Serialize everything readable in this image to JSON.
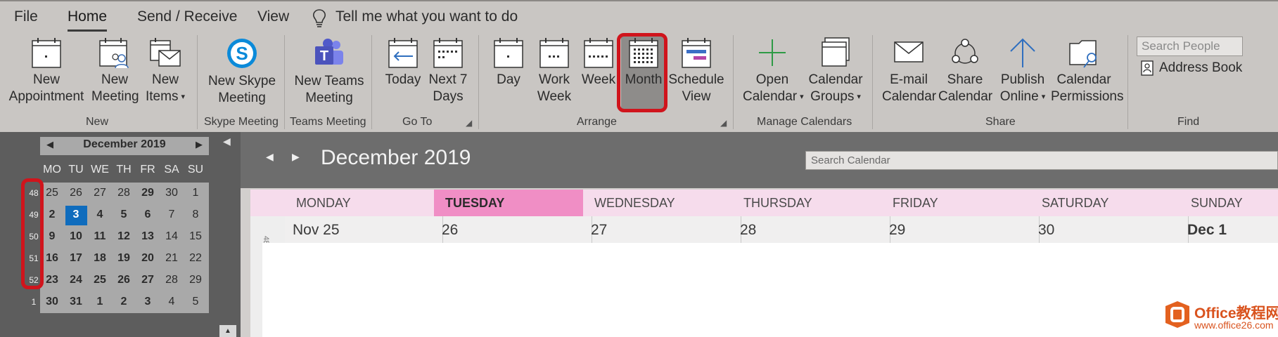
{
  "menu": {
    "file": "File",
    "home": "Home",
    "send_receive": "Send / Receive",
    "view": "View",
    "tell_me": "Tell me what you want to do"
  },
  "ribbon": {
    "new_group": {
      "label": "New",
      "new_appointment": [
        "New",
        "Appointment"
      ],
      "new_meeting": [
        "New",
        "Meeting"
      ],
      "new_items": [
        "New",
        "Items"
      ]
    },
    "skype_group": {
      "label": "Skype Meeting",
      "button": [
        "New Skype",
        "Meeting"
      ]
    },
    "teams_group": {
      "label": "Teams Meeting",
      "button": [
        "New Teams",
        "Meeting"
      ]
    },
    "goto_group": {
      "label": "Go To",
      "today": [
        "Today"
      ],
      "next7": [
        "Next 7",
        "Days"
      ]
    },
    "arrange_group": {
      "label": "Arrange",
      "day": [
        "Day"
      ],
      "work_week": [
        "Work",
        "Week"
      ],
      "week": [
        "Week"
      ],
      "month": [
        "Month"
      ],
      "schedule_view": [
        "Schedule",
        "View"
      ]
    },
    "manage_group": {
      "label": "Manage Calendars",
      "open_calendar": [
        "Open",
        "Calendar"
      ],
      "calendar_groups": [
        "Calendar",
        "Groups"
      ]
    },
    "share_group": {
      "label": "Share",
      "email_calendar": [
        "E-mail",
        "Calendar"
      ],
      "share_calendar": [
        "Share",
        "Calendar"
      ],
      "publish_online": [
        "Publish",
        "Online"
      ],
      "calendar_permissions": [
        "Calendar",
        "Permissions"
      ]
    },
    "find_group": {
      "label": "Find",
      "search_people_placeholder": "Search People",
      "address_book": "Address Book"
    }
  },
  "mini_calendar": {
    "title": "December 2019",
    "days_of_week": [
      "MO",
      "TU",
      "WE",
      "TH",
      "FR",
      "SA",
      "SU"
    ],
    "weeks": [
      {
        "week": "48",
        "days": [
          "25",
          "26",
          "27",
          "28",
          "29",
          "30",
          "1"
        ]
      },
      {
        "week": "49",
        "days": [
          "2",
          "3",
          "4",
          "5",
          "6",
          "7",
          "8"
        ]
      },
      {
        "week": "50",
        "days": [
          "9",
          "10",
          "11",
          "12",
          "13",
          "14",
          "15"
        ]
      },
      {
        "week": "51",
        "days": [
          "16",
          "17",
          "18",
          "19",
          "20",
          "21",
          "22"
        ]
      },
      {
        "week": "52",
        "days": [
          "23",
          "24",
          "25",
          "26",
          "27",
          "28",
          "29"
        ]
      },
      {
        "week": "1",
        "days": [
          "30",
          "31",
          "1",
          "2",
          "3",
          "4",
          "5"
        ]
      }
    ],
    "today": "3"
  },
  "calendar": {
    "title": "December 2019",
    "search_placeholder": "Search Calendar",
    "day_headers": [
      "MONDAY",
      "TUESDAY",
      "WEDNESDAY",
      "THURSDAY",
      "FRIDAY",
      "SATURDAY",
      "SUNDAY"
    ],
    "today_header": "TUESDAY",
    "first_row_dates": [
      "Nov 25",
      "26",
      "27",
      "28",
      "29",
      "30",
      "Dec 1"
    ],
    "week_label": "48"
  },
  "watermark": {
    "name": "Office教程网",
    "url": "www.office26.com"
  },
  "colors": {
    "highlight": "#d0141c",
    "today": "#0f6cbd",
    "today_header": "#f08ec5",
    "header_row": "#f6dcec"
  }
}
